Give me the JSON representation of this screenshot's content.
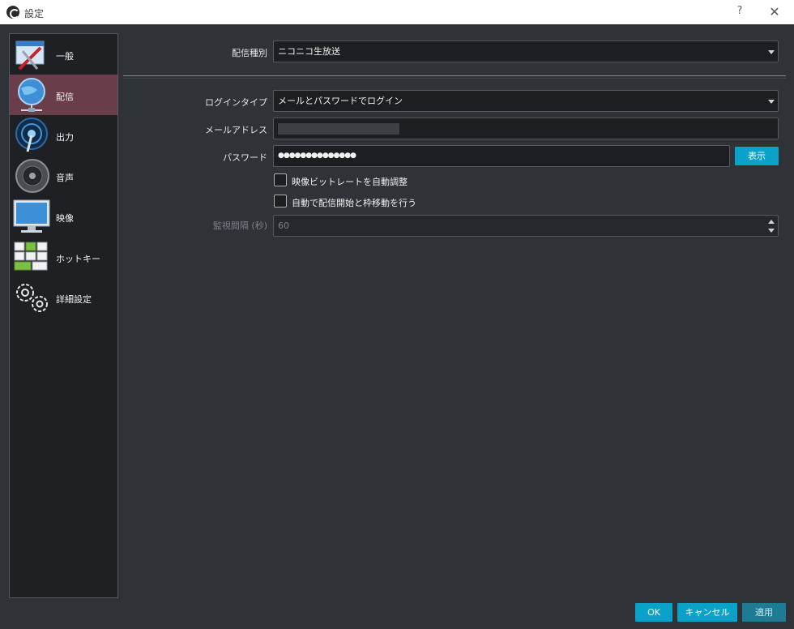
{
  "window": {
    "title": "設定",
    "help": "?",
    "close": "✕"
  },
  "sidebar": {
    "items": [
      {
        "label": "一般",
        "icon": "general-tools-icon",
        "active": false
      },
      {
        "label": "配信",
        "icon": "globe-network-icon",
        "active": true
      },
      {
        "label": "出力",
        "icon": "broadcast-antenna-icon",
        "active": false
      },
      {
        "label": "音声",
        "icon": "speaker-icon",
        "active": false
      },
      {
        "label": "映像",
        "icon": "monitor-icon",
        "active": false
      },
      {
        "label": "ホットキー",
        "icon": "keyboard-icon",
        "active": false
      },
      {
        "label": "詳細設定",
        "icon": "gears-icon",
        "active": false
      }
    ]
  },
  "stream": {
    "service_label": "配信種別",
    "service_value": "ニコニコ生放送",
    "login_type_label": "ログインタイプ",
    "login_type_value": "メールとパスワードでログイン",
    "email_label": "メールアドレス",
    "email_value": "",
    "password_label": "パスワード",
    "password_value": "●●●●●●●●●●●●●●",
    "show_button": "表示",
    "auto_bitrate_label": "映像ビットレートを自動調整",
    "auto_start_label": "自動で配信開始と枠移動を行う",
    "interval_label": "監視間隔 (秒)",
    "interval_value": "60"
  },
  "footer": {
    "ok": "OK",
    "cancel": "キャンセル",
    "apply": "適用"
  },
  "colors": {
    "accent": "#0aa2c8",
    "active_nav": "#6a3d4b",
    "background": "#2f3237"
  }
}
